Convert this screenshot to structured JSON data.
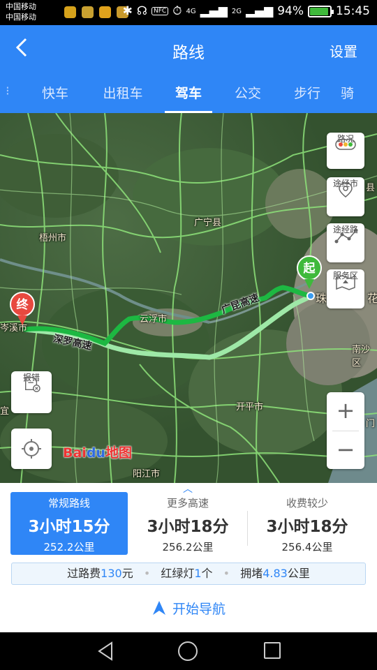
{
  "status": {
    "carrier1": "中国移动",
    "carrier2": "中国移动",
    "network1": "4G",
    "network2": "2G",
    "battery": "94%",
    "battery_fraction": 0.94,
    "time": "15:45",
    "nfc": "NFC"
  },
  "header": {
    "title": "路线",
    "settings": "设置"
  },
  "tabs": [
    {
      "label": "快车"
    },
    {
      "label": "出租车"
    },
    {
      "label": "驾车",
      "active": true
    },
    {
      "label": "公交"
    },
    {
      "label": "步行"
    },
    {
      "label": "骑"
    }
  ],
  "map": {
    "labels": {
      "wuzhou": "梧州市",
      "yunfu": "云浮市",
      "guangning": "广宁县",
      "cenxi": "岑溪市",
      "kaiping": "开平市",
      "yangjiang": "阳江市",
      "nansha": "南沙区",
      "zhu": "珠",
      "hua": "花",
      "road1": "广昆高速",
      "road2": "深罗高速",
      "xian": "县",
      "yi": "宜",
      "men": "门"
    },
    "buttons": {
      "traffic": "路况",
      "via_city": "途经市",
      "via_road": "途经路",
      "service": "服务区",
      "report": "报错"
    },
    "markers": {
      "start": "起",
      "end": "终"
    },
    "logo": {
      "bai": "Bai",
      "du": "du",
      "ditu": "地图"
    },
    "colors": {
      "route_main": "#1db842",
      "route_alt": "#9ee8a7",
      "accent": "#2f86f6"
    }
  },
  "routes": [
    {
      "name": "常规路线",
      "time": "3小时15分",
      "distance": "252.2公里",
      "selected": true
    },
    {
      "name": "更多高速",
      "time": "3小时18分",
      "distance": "256.2公里"
    },
    {
      "name": "收费较少",
      "time": "3小时18分",
      "distance": "256.4公里"
    }
  ],
  "summary": {
    "toll_label": "过路费",
    "toll_value": "130",
    "toll_unit": "元",
    "lights_label": "红绿灯",
    "lights_value": "1",
    "lights_unit": "个",
    "jam_label": "拥堵",
    "jam_value": "4.83",
    "jam_unit": "公里"
  },
  "start_nav": "开始导航"
}
